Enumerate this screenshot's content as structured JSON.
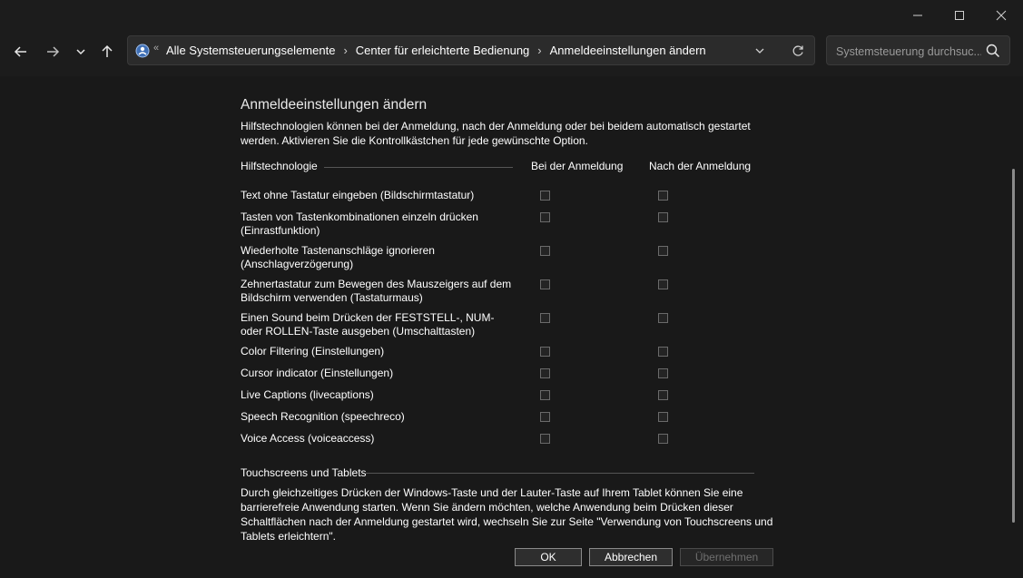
{
  "window": {
    "controls": {
      "minimize_icon": "minimize-icon",
      "maximize_icon": "maximize-icon",
      "close_icon": "close-icon"
    }
  },
  "nav": {
    "back_icon": "arrow-left-icon",
    "forward_icon": "arrow-right-icon",
    "recent_icon": "chevron-down-icon",
    "up_icon": "arrow-up-icon"
  },
  "breadcrumb": {
    "overflow": "«",
    "items": [
      {
        "label": "Alle Systemsteuerungselemente"
      },
      {
        "label": "Center für erleichterte Bedienung"
      },
      {
        "label": "Anmeldeeinstellungen ändern"
      }
    ]
  },
  "search": {
    "placeholder": "Systemsteuerung durchsuc..."
  },
  "page": {
    "title": "Anmeldeeinstellungen ändern",
    "intro": "Hilfstechnologien können bei der Anmeldung, nach der Anmeldung oder bei beidem automatisch gestartet werden. Aktivieren Sie die Kontrollkästchen für jede gewünschte Option.",
    "columns": {
      "tech": "Hilfstechnologie",
      "at_login": "Bei der Anmeldung",
      "after_login": "Nach der Anmeldung"
    },
    "rows": [
      {
        "label": "Text ohne Tastatur eingeben (Bildschirmtastatur)",
        "at_login": false,
        "after_login": false
      },
      {
        "label": "Tasten von Tastenkombinationen einzeln drücken (Einrastfunktion)",
        "at_login": false,
        "after_login": false
      },
      {
        "label": "Wiederholte Tastenanschläge ignorieren (Anschlagverzögerung)",
        "at_login": false,
        "after_login": false
      },
      {
        "label": "Zehnertastatur zum Bewegen des Mauszeigers auf dem Bildschirm verwenden (Tastaturmaus)",
        "at_login": false,
        "after_login": false
      },
      {
        "label": "Einen Sound beim Drücken der FESTSTELL-, NUM- oder ROLLEN-Taste ausgeben (Umschalttasten)",
        "at_login": false,
        "after_login": false
      },
      {
        "label": "Color Filtering (Einstellungen)",
        "at_login": false,
        "after_login": false
      },
      {
        "label": "Cursor indicator (Einstellungen)",
        "at_login": false,
        "after_login": false
      },
      {
        "label": "Live Captions (livecaptions)",
        "at_login": false,
        "after_login": false
      },
      {
        "label": "Speech Recognition (speechreco)",
        "at_login": false,
        "after_login": false
      },
      {
        "label": "Voice Access (voiceaccess)",
        "at_login": false,
        "after_login": false
      }
    ],
    "touch": {
      "title": "Touchscreens und Tablets",
      "text": "Durch gleichzeitiges Drücken der Windows-Taste und der Lauter-Taste auf Ihrem Tablet können Sie eine barrierefreie Anwendung starten. Wenn Sie ändern möchten, welche Anwendung beim Drücken dieser Schaltflächen nach der Anmeldung gestartet wird, wechseln Sie zur Seite \"Verwendung von Touchscreens und Tablets erleichtern\"."
    }
  },
  "buttons": {
    "ok": "OK",
    "cancel": "Abbrechen",
    "apply": "Übernehmen"
  }
}
